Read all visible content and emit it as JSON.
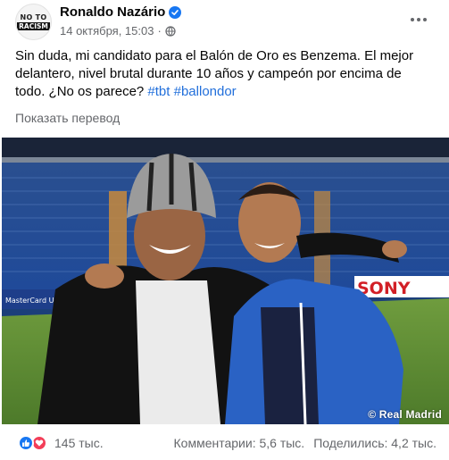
{
  "author": {
    "name": "Ronaldo Nazário",
    "avatar_text_top": "NO TO",
    "avatar_text_bottom": "RACISM"
  },
  "meta": {
    "date": "14 октября, 15:03",
    "separator": "·"
  },
  "post": {
    "text": "Sin duda, mi candidato para el Balón de Oro es Benzema. El mejor delantero, nivel brutal durante 10 años y campeón por encima de todo. ¿No os parece? ",
    "hashtags": [
      "#tbt",
      "#ballondor"
    ],
    "translate_label": "Показать перевод"
  },
  "photo": {
    "credit": "© Real Madrid",
    "banner_text": "SONY",
    "left_banner_text": "MasterCard UEFA"
  },
  "footer": {
    "reaction_count": "145 тыс.",
    "comments": "Комментарии: 5,6 тыс.",
    "shares": "Поделились: 4,2 тыс."
  },
  "colors": {
    "hashtag": "#216fdb",
    "verified": "#1877f2",
    "like": "#1877f2",
    "love": "#f33e58",
    "meta": "#65676b"
  },
  "icons": [
    "verified-badge-icon",
    "globe-icon",
    "more-options-icon",
    "like-reaction-icon",
    "love-reaction-icon"
  ]
}
